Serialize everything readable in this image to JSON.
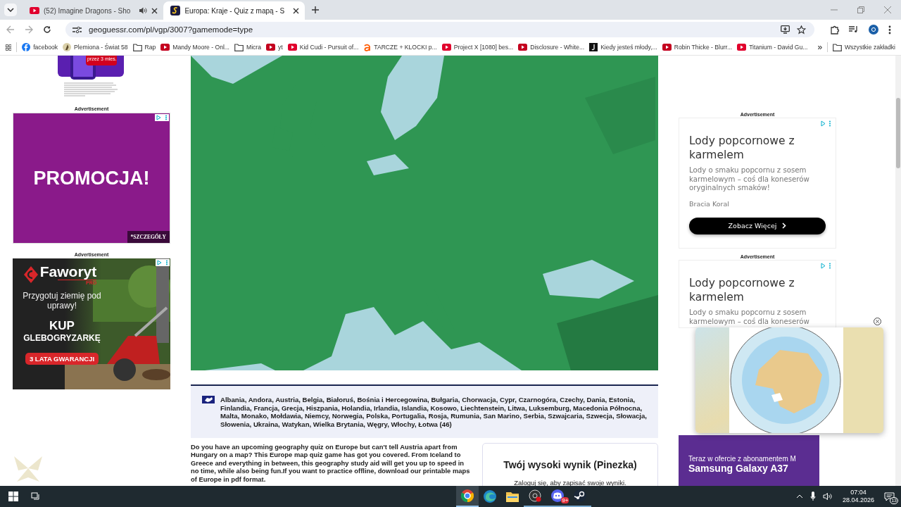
{
  "browser": {
    "tabs": [
      {
        "title": "(52) Imagine Dragons - Sho",
        "kind": "video",
        "audio": true,
        "selected": false
      },
      {
        "title": "Europa: Kraje - Quiz z mapą - S",
        "kind": "site",
        "audio": false,
        "selected": true
      }
    ],
    "address": "geoguessr.com/pl/vgp/3007?gamemode=type",
    "bookmarks": [
      {
        "title": "facebook",
        "kind": "facebook"
      },
      {
        "title": "Plemiona - Świat 58",
        "kind": "site"
      },
      {
        "title": "Rap",
        "kind": "folder"
      },
      {
        "title": "Mandy Moore - Onl...",
        "kind": "video"
      },
      {
        "title": "Micra",
        "kind": "folder"
      },
      {
        "title": "yt",
        "kind": "video"
      },
      {
        "title": "Kid Cudi - Pursuit of...",
        "kind": "video"
      },
      {
        "title": "TARCZE + KLOCKI p...",
        "kind": "shop"
      },
      {
        "title": "Project X [1080] bes...",
        "kind": "video"
      },
      {
        "title": "Disclosure - White...",
        "kind": "video"
      },
      {
        "title": "Kiedy jesteś młody,...",
        "kind": "doc"
      },
      {
        "title": "Robin Thicke - Blurr...",
        "kind": "video"
      },
      {
        "title": "Titanium - David Gu...",
        "kind": "video"
      }
    ],
    "more_bookmarks": "»",
    "all_bookmarks": "Wszystkie zakładki"
  },
  "left_ads": {
    "top_offer": "przez 3 mies.",
    "promo_ad": {
      "label": "Advertisement",
      "headline": "PROMOCJA!",
      "details": "*SZCZEGÓŁY"
    },
    "tiller_ad": {
      "label": "Advertisement",
      "brand": "Faworyt",
      "brand_sub": "PRO",
      "tagline": "Przygotuj ziemię pod uprawy!",
      "cta_top": "KUP",
      "cta_main": "GLEBOGRYZARKĘ",
      "badge": "3 LATA GWARANCJI"
    }
  },
  "quiz": {
    "countries": "Albania, Andora, Austria, Belgia, Białoruś, Bośnia i Hercegowina, Bułgaria, Chorwacja, Cypr, Czarnogóra, Czechy, Dania, Estonia, Finlandia, Francja, Grecja, Hiszpania, Holandia, Irlandia, Islandia, Kosowo, Liechtenstein, Litwa, Luksemburg, Macedonia Północna, Malta, Monako, Mołdawia, Niemcy, Norwegia, Polska, Portugalia, Rosja, Rumunia, San Marino, Serbia, Szwajcaria, Szwecja, Słowacja, Słowenia, Ukraina, Watykan, Wielka Brytania, Węgry, Włochy, Łotwa (46)",
    "description": "Do you have an upcoming geography quiz on Europe but can't tell Austria apart from Hungary on a map? This Europe map quiz game has got you covered. From Iceland to Greece and everything in between, this geography study aid will get you up to speed in no time, while also being fun.If you want to practice offline, download our printable maps of Europe in pdf format.",
    "high_score": {
      "title": "Twój wysoki wynik (Pinezka)",
      "login_prompt": "Zaloguj się, aby zapisać swoje wyniki."
    }
  },
  "right_ads": {
    "ads": [
      {
        "label": "Advertisement",
        "title": "Lody popcornowe z karmelem",
        "description": "Lody o smaku popcornu z sosem karmelowym – coś dla koneserów oryginalnych smaków!",
        "brand": "Bracia Koral",
        "button": "Zobacz Więcej"
      },
      {
        "label": "Advertisement",
        "title": "Lody popcornowe z karmelem",
        "description": "Lody o smaku popcornu z sosem karmelowym – coś dla koneserów"
      }
    ],
    "play_ad": {
      "offer": "Teraz w ofercie z abonamentem M",
      "model": "Samsung Galaxy A37"
    }
  },
  "taskbar": {
    "apps": [
      {
        "kind": "chrome",
        "running": true,
        "selected": true
      },
      {
        "kind": "edge",
        "running": false,
        "selected": false
      },
      {
        "kind": "files",
        "running": false,
        "selected": false
      },
      {
        "kind": "recorder",
        "running": true,
        "selected": false
      },
      {
        "kind": "chat",
        "running": true,
        "selected": false,
        "badge": "9+"
      },
      {
        "kind": "steam",
        "running": true,
        "selected": false
      }
    ],
    "time": "07:04",
    "date": "28.04.2026",
    "notifications": "13"
  }
}
